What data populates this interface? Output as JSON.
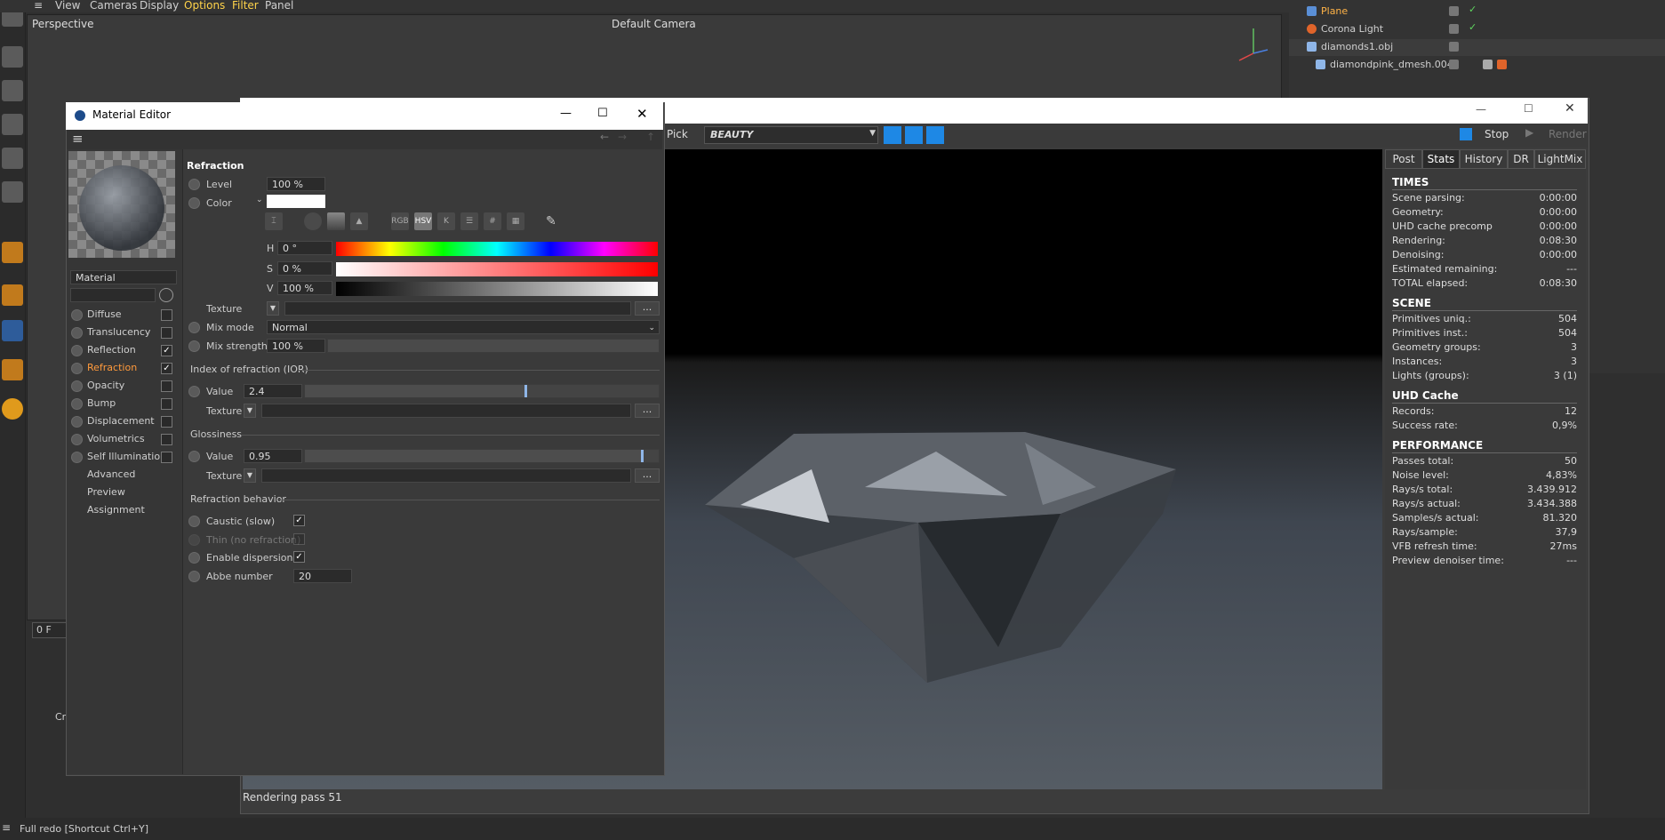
{
  "c4d": {
    "menu": [
      "View",
      "Cameras",
      "Display",
      "Options",
      "Filter",
      "Panel"
    ],
    "viewport_title": "Perspective",
    "viewport_camera": "Default Camera",
    "frame_field": "0 F",
    "frame_marker": "0",
    "status_bar": "Full redo [Shortcut Ctrl+Y]",
    "bottom_left_label": "Cr"
  },
  "objects": [
    {
      "name": "Plane",
      "highlight": "#ffb347"
    },
    {
      "name": "Corona Light",
      "highlight": "#dddddd"
    },
    {
      "name": "diamonds1.obj",
      "highlight": "#dddddd"
    },
    {
      "name": "diamondpink_dmesh.004",
      "highlight": "#dddddd"
    }
  ],
  "vfb": {
    "pick_label": "Pick",
    "channel": "BEAUTY",
    "stop_label": "Stop",
    "render_label": "Render",
    "status": "Rendering pass 51",
    "tabs": [
      "Post",
      "Stats",
      "History",
      "DR",
      "LightMix"
    ],
    "sections": [
      {
        "title": "TIMES",
        "rows": [
          [
            "Scene parsing:",
            "0:00:00"
          ],
          [
            "Geometry:",
            "0:00:00"
          ],
          [
            "UHD cache precomp",
            "0:00:00"
          ],
          [
            "Rendering:",
            "0:08:30"
          ],
          [
            "Denoising:",
            "0:00:00"
          ],
          [
            "Estimated remaining:",
            "---"
          ],
          [
            "TOTAL elapsed:",
            "0:08:30"
          ]
        ]
      },
      {
        "title": "SCENE",
        "rows": [
          [
            "Primitives uniq.:",
            "504"
          ],
          [
            "Primitives inst.:",
            "504"
          ],
          [
            "Geometry groups:",
            "3"
          ],
          [
            "Instances:",
            "3"
          ],
          [
            "Lights (groups):",
            "3 (1)"
          ]
        ]
      },
      {
        "title": "UHD Cache",
        "rows": [
          [
            "Records:",
            "12"
          ],
          [
            "Success rate:",
            "0,9%"
          ]
        ]
      },
      {
        "title": "PERFORMANCE",
        "rows": [
          [
            "Passes total:",
            "50"
          ],
          [
            "Noise level:",
            "4,83%"
          ],
          [
            "Rays/s total:",
            "3.439.912"
          ],
          [
            "Rays/s actual:",
            "3.434.388"
          ],
          [
            "Samples/s actual:",
            "81.320"
          ],
          [
            "Rays/sample:",
            "37,9"
          ],
          [
            "VFB refresh time:",
            "27ms"
          ],
          [
            "Preview denoiser time:",
            "---"
          ]
        ]
      }
    ]
  },
  "material_editor": {
    "title": "Material Editor",
    "material_name": "Material",
    "channels": [
      {
        "label": "Diffuse",
        "checked": false,
        "has_check": true,
        "active": false
      },
      {
        "label": "Translucency",
        "checked": false,
        "has_check": true,
        "active": false
      },
      {
        "label": "Reflection",
        "checked": true,
        "has_check": true,
        "active": false
      },
      {
        "label": "Refraction",
        "checked": true,
        "has_check": true,
        "active": true
      },
      {
        "label": "Opacity",
        "checked": false,
        "has_check": true,
        "active": false
      },
      {
        "label": "Bump",
        "checked": false,
        "has_check": true,
        "active": false
      },
      {
        "label": "Displacement",
        "checked": false,
        "has_check": true,
        "active": false
      },
      {
        "label": "Volumetrics",
        "checked": false,
        "has_check": true,
        "active": false
      },
      {
        "label": "Self Illumination",
        "checked": false,
        "has_check": true,
        "active": false
      },
      {
        "label": "Advanced",
        "checked": false,
        "has_check": false,
        "active": false
      },
      {
        "label": "Preview",
        "checked": false,
        "has_check": false,
        "active": false
      },
      {
        "label": "Assignment",
        "checked": false,
        "has_check": false,
        "active": false
      }
    ],
    "refraction": {
      "heading": "Refraction",
      "level_label": "Level",
      "level_value": "100 %",
      "color_label": "Color",
      "color_mode_buttons": [
        "RGB",
        "HSV",
        "K",
        "#"
      ],
      "h_label": "H",
      "h_value": "0 °",
      "s_label": "S",
      "s_value": "0 %",
      "v_label": "V",
      "v_value": "100 %",
      "texture_label": "Texture",
      "mix_mode_label": "Mix mode",
      "mix_mode_value": "Normal",
      "mix_strength_label": "Mix strength",
      "mix_strength_value": "100 %",
      "ior_section": "Index of refraction (IOR)",
      "ior_value_label": "Value",
      "ior_value": "2.4",
      "ior_fraction": 0.62,
      "ior_texture_label": "Texture",
      "gloss_section": "Glossiness",
      "gloss_value_label": "Value",
      "gloss_value": "0.95",
      "gloss_fraction": 0.95,
      "gloss_texture_label": "Texture",
      "behavior_section": "Refraction behavior",
      "caustic_label": "Caustic (slow)",
      "caustic_checked": true,
      "thin_label": "Thin (no refraction)",
      "thin_checked": false,
      "dispersion_label": "Enable dispersion",
      "dispersion_checked": true,
      "abbe_label": "Abbe number",
      "abbe_value": "20",
      "dots_label": "..."
    }
  },
  "colors": {
    "accent_orange": "#ff9a3c",
    "vfb_blue": "#1e88e5"
  }
}
